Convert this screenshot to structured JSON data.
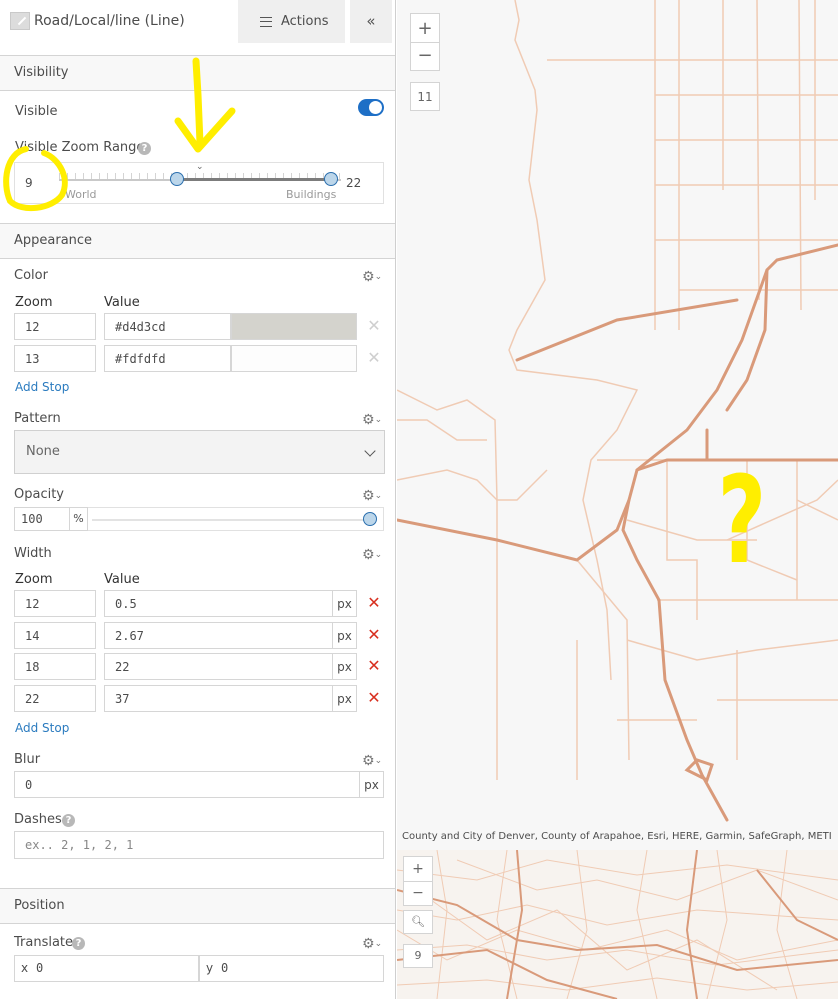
{
  "header": {
    "layer_title": "Road/Local/line (Line)",
    "actions_label": "Actions",
    "collapse_glyph": "«"
  },
  "visibility": {
    "section_title": "Visibility",
    "visible_label": "Visible",
    "visible_on": true,
    "zoom_range_label": "Visible Zoom Range",
    "zoom_min": "9",
    "zoom_max": "22",
    "world_label": "World",
    "buildings_label": "Buildings"
  },
  "appearance": {
    "section_title": "Appearance",
    "color": {
      "label": "Color",
      "zoom_header": "Zoom",
      "value_header": "Value",
      "stops": [
        {
          "zoom": "12",
          "value": "#d4d3cd"
        },
        {
          "zoom": "13",
          "value": "#fdfdfd"
        }
      ],
      "add_stop": "Add Stop"
    },
    "pattern": {
      "label": "Pattern",
      "selected": "None"
    },
    "opacity": {
      "label": "Opacity",
      "value": "100",
      "unit": "%",
      "fraction": 1.0
    },
    "width": {
      "label": "Width",
      "zoom_header": "Zoom",
      "value_header": "Value",
      "unit": "px",
      "stops": [
        {
          "zoom": "12",
          "value": "0.5"
        },
        {
          "zoom": "14",
          "value": "2.67"
        },
        {
          "zoom": "18",
          "value": "22"
        },
        {
          "zoom": "22",
          "value": "37"
        }
      ],
      "add_stop": "Add Stop"
    },
    "blur": {
      "label": "Blur",
      "value": "0",
      "unit": "px"
    },
    "dashes": {
      "label": "Dashes",
      "placeholder": "ex.. 2, 1, 2, 1"
    }
  },
  "position": {
    "section_title": "Position",
    "translate_label": "Translate",
    "x_label": "x",
    "x_value": "0",
    "y_label": "y",
    "y_value": "0"
  },
  "map": {
    "zoom_in": "+",
    "zoom_out": "−",
    "zoom_level": "11",
    "attribution": "County and City of Denver, County of Arapahoe, Esri, HERE, Garmin, SafeGraph, METI",
    "annotation_mark": "?"
  },
  "minimap": {
    "zoom_in": "+",
    "zoom_out": "−",
    "zoom_level": "9"
  },
  "colors": {
    "road_light": "#f0cbb4",
    "road_major": "#d99a7a",
    "toggle_on": "#1e6fc6",
    "delete_red": "#d83020",
    "link_blue": "#2b7bbf",
    "annotation_yellow": "#ffee00"
  }
}
